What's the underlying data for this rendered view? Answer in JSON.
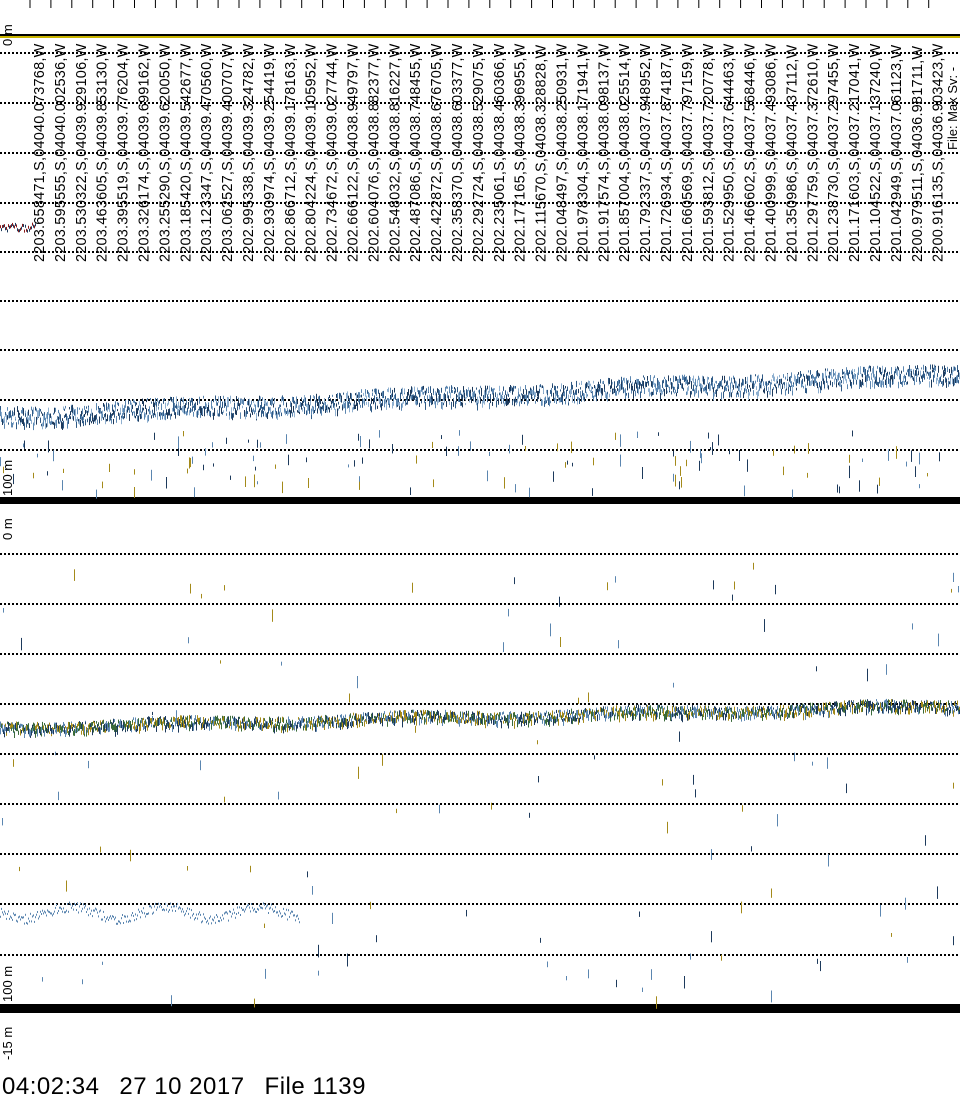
{
  "echogram": {
    "gps_labels": [
      "2203.658471,S,04040.073768,W",
      "2203.595555,S,04040.002536,W",
      "2203.530322,S,04039.929106,W",
      "2203.463605,S,04039.853130,W",
      "2203.395519,S,04039.776204,W",
      "2203.326174,S,04039.699162,W",
      "2203.255290,S,04039.620050,W",
      "2203.185420,S,04039.542677,W",
      "2203.123347,S,04039.470560,W",
      "2203.062527,S,04039.400707,W",
      "2202.995338,S,04039.324782,W",
      "2202.930974,S,04039.254419,W",
      "2202.866712,S,04039.178163,W",
      "2202.804224,S,04039.105952,W",
      "2202.734672,S,04039.027744,W",
      "2202.666122,S,04038.949797,W",
      "2202.604076,S,04038.882377,W",
      "2202.548032,S,04038.816227,W",
      "2202.487086,S,04038.748455,W",
      "2202.422872,S,04038.676705,W",
      "2202.358370,S,04038.603377,W",
      "2202.292724,S,04038.529075,W",
      "2202.235061,S,04038.460366,W",
      "2202.177165,S,04038.396955,W",
      "2202.115670,S,04038.328828,W",
      "2202.048497,S,04038.250931,W",
      "2201.978304,S,04038.171941,W",
      "2201.917574,S,04038.098137,W",
      "2201.857004,S,04038.025514,W",
      "2201.792337,S,04037.948952,W",
      "2201.726934,S,04037.874187,W",
      "2201.660569,S,04037.797159,W",
      "2201.593812,S,04037.720778,W",
      "2201.529950,S,04037.644463,W",
      "2201.466602,S,04037.568446,W",
      "2201.400999,S,04037.493086,W",
      "2201.350986,S,04037.437112,W",
      "2201.297759,S,04037.372610,W",
      "2201.238730,S,04037.297455,W",
      "2201.171603,S,04037.217041,W",
      "2201.104522,S,04037.137240,W",
      "2201.042949,S,04037.061123,W",
      "2200.979511,S,04036.981711,W",
      "2200.916135,S,04036.903423,W"
    ],
    "top_panel": {
      "depth_top_label": "0 m",
      "depth_bottom_label": "100 m"
    },
    "bottom_panel": {
      "depth_top_label": "0 m",
      "depth_bottom_label": "100 m",
      "depth_extra_label": "-15 m"
    },
    "corner_fragment": "File: Max Sv: -"
  },
  "footer": {
    "time": "04:02:34",
    "date": "27 10 2017",
    "file": "File 1139"
  }
}
